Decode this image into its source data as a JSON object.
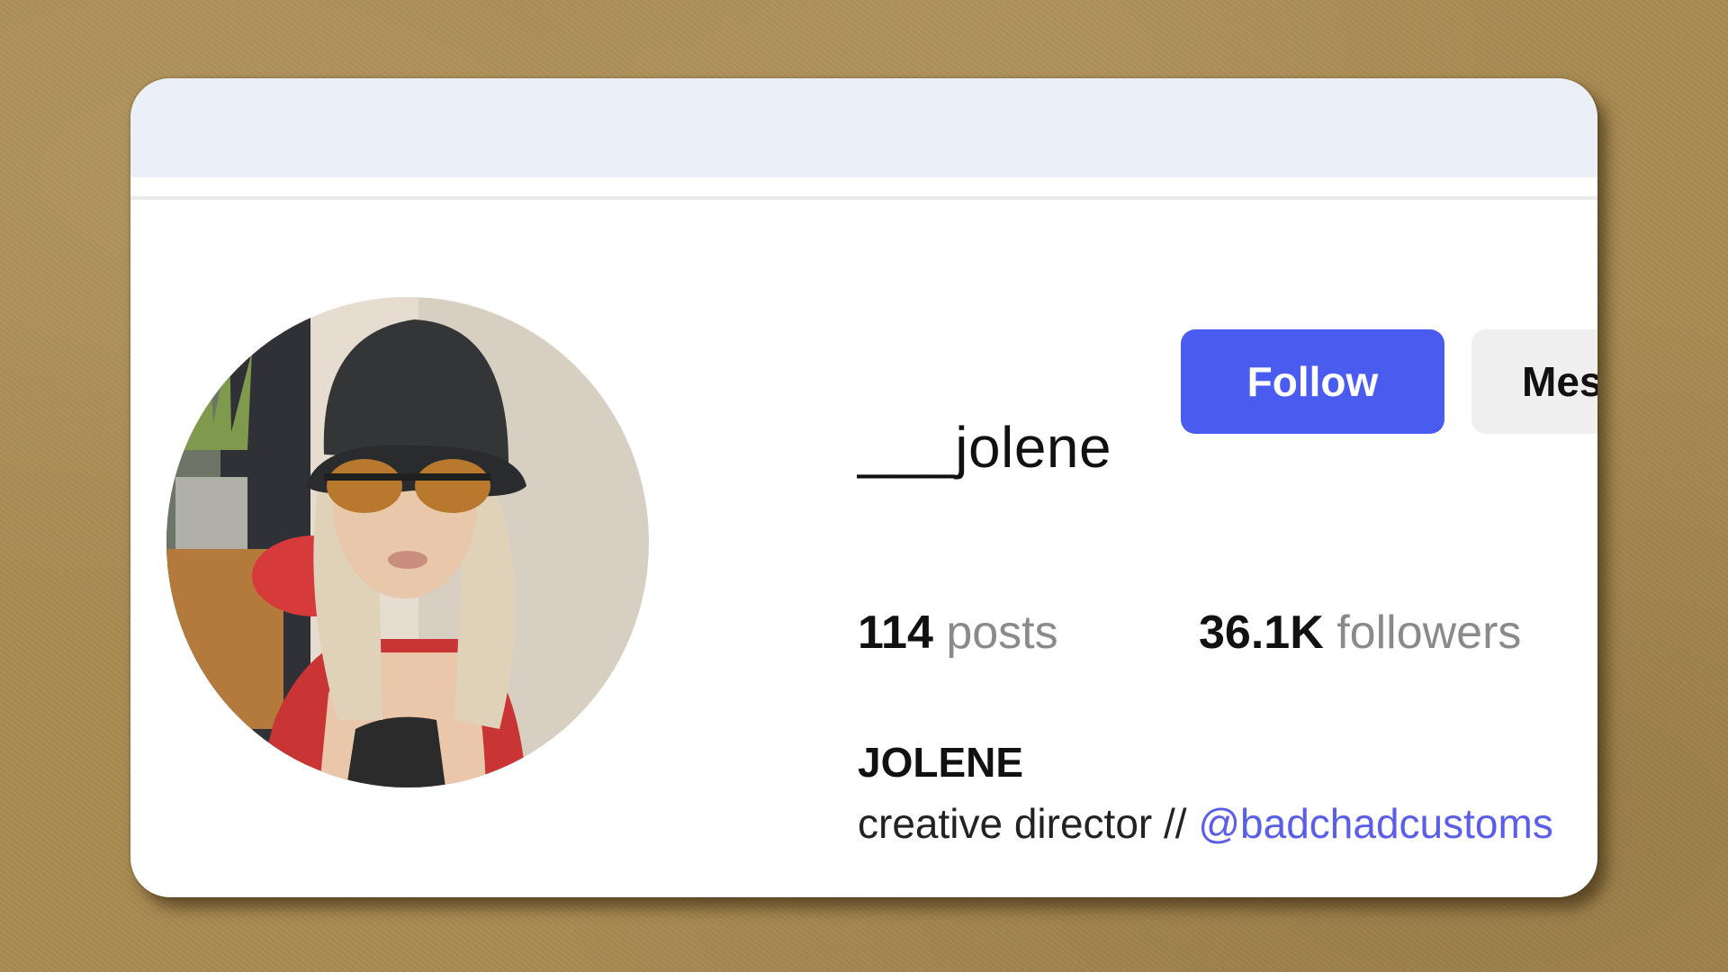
{
  "profile": {
    "username": "___jolene",
    "follow_label": "Follow",
    "message_label": "Message",
    "stats": {
      "posts_count": "114",
      "posts_label": "posts",
      "followers_count": "36.1K",
      "followers_label": "followers"
    },
    "display_name": "JOLENE",
    "bio_text": "creative director // ",
    "bio_link": "@badchadcustoms"
  },
  "colors": {
    "follow_button": "#4a5cf0",
    "message_button": "#efefef",
    "link": "#5b5fe8",
    "top_bar": "#ebf0f8",
    "background": "#a88a52"
  }
}
